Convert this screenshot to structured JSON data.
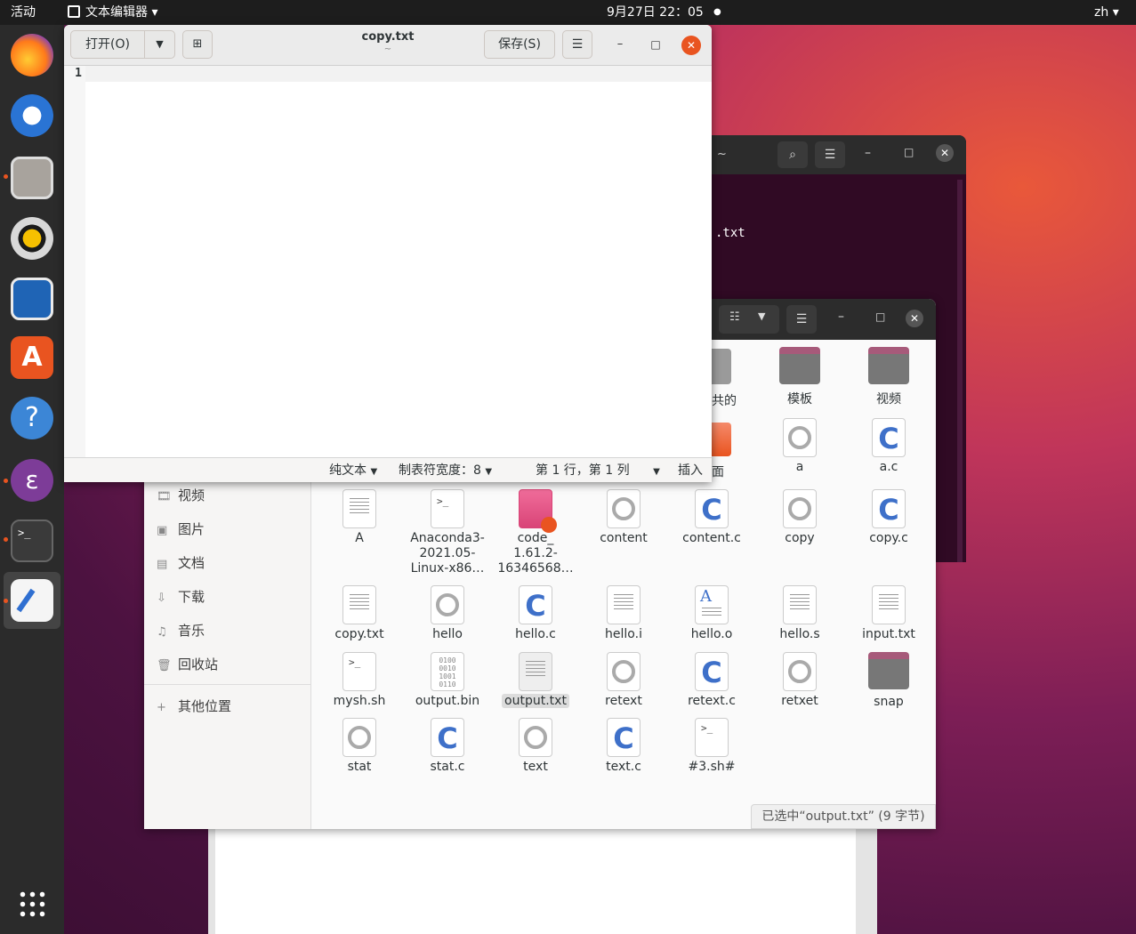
{
  "topbar": {
    "activities": "活动",
    "app_menu": "文本编辑器",
    "clock": "9月27日  22：05",
    "lang": "zh"
  },
  "editor": {
    "title": "copy.txt",
    "subtitle": "~",
    "open_label": "打开(O)",
    "save_label": "保存(S)",
    "line_number": "1",
    "status_syntax": "纯文本",
    "status_tab": "制表符宽度：8",
    "status_pos": "第 1 行，第 1 列",
    "status_mode": "插入"
  },
  "terminal": {
    "title_tail": "~",
    "visible_text": ".txt"
  },
  "files": {
    "sidebar": [
      {
        "label": "视频",
        "icon": "film-icon"
      },
      {
        "label": "图片",
        "icon": "image-icon"
      },
      {
        "label": "文档",
        "icon": "document-icon"
      },
      {
        "label": "下载",
        "icon": "download-icon"
      },
      {
        "label": "音乐",
        "icon": "music-icon"
      },
      {
        "label": "回收站",
        "icon": "trash-icon"
      },
      {
        "label": "其他位置",
        "icon": "plus-icon"
      }
    ],
    "partial_labels": [
      "共的",
      "面"
    ],
    "top_folders": [
      "模板",
      "视频"
    ],
    "row0": [
      "a",
      "a.c"
    ],
    "row1": [
      "A",
      "Anaconda3-\n2021.05-\nLinux-x86…",
      "code_\n1.61.2-\n16346568…",
      "content",
      "content.c",
      "copy",
      "copy.c"
    ],
    "row2": [
      "copy.txt",
      "hello",
      "hello.c",
      "hello.i",
      "hello.o",
      "hello.s",
      "input.txt"
    ],
    "row3": [
      "mysh.sh",
      "output.bin",
      "output.txt",
      "retext",
      "retext.c",
      "retxet",
      "snap"
    ],
    "row4": [
      "stat",
      "stat.c",
      "text",
      "text.c",
      "#3.sh#"
    ],
    "status": "已选中“output.txt” (9 字节)"
  },
  "colors": {
    "accent": "#e95420",
    "dock_bg": "#2b2b2b",
    "topbar_bg": "#1d1d1d"
  }
}
